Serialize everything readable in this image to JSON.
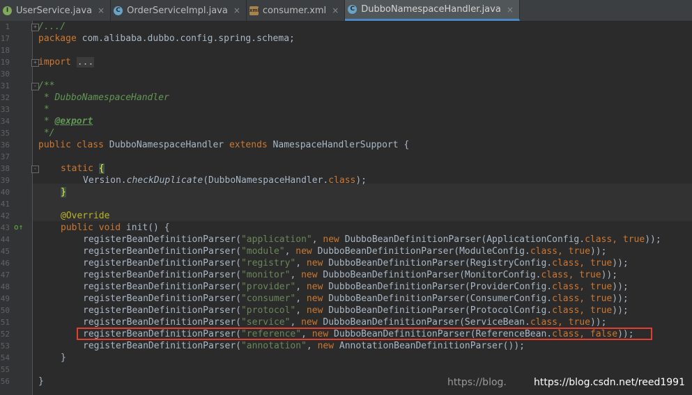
{
  "tabs": [
    {
      "icon": "I",
      "kind": "iface",
      "label": "UserService.java",
      "active": false
    },
    {
      "icon": "C",
      "kind": "cls",
      "label": "OrderServiceImpl.java",
      "active": false
    },
    {
      "icon": "xml",
      "kind": "xml",
      "label": "consumer.xml",
      "active": false
    },
    {
      "icon": "C",
      "kind": "cls",
      "label": "DubboNamespaceHandler.java",
      "active": true
    }
  ],
  "close_glyph": "×",
  "line_numbers": [
    "1",
    "17",
    "18",
    "19",
    "30",
    "31",
    "32",
    "33",
    "34",
    "35",
    "36",
    "37",
    "38",
    "39",
    "40",
    "41",
    "42",
    "43",
    "44",
    "45",
    "46",
    "47",
    "48",
    "49",
    "50",
    "51",
    "52",
    "53",
    "54",
    "55",
    "56"
  ],
  "code": {
    "l1": "/.../",
    "l17_kw": "package",
    "l17_rest": " com.alibaba.dubbo.config.spring.schema;",
    "l19_kw": "import",
    "l19_dots": "...",
    "l31": "/**",
    "l32": " * DubboNamespaceHandler",
    "l33": " *",
    "l34_pre": " * ",
    "l34_tag": "@export",
    "l35": " */",
    "l36_kw1": "public class",
    "l36_name": " DubboNamespaceHandler ",
    "l36_kw2": "extends",
    "l36_rest": " NamespaceHandlerSupport {",
    "l38_kw": "static",
    "l38_brace": "{",
    "l39_a": "Version.",
    "l39_method": "checkDuplicate",
    "l39_b": "(DubboNamespaceHandler.",
    "l39_kw": "class",
    "l39_c": ");",
    "l40_brace": "}",
    "l42": "@Override",
    "l43_kw": "public void",
    "l43_rest": " init() {",
    "reg": "registerBeanDefinitionParser(",
    "new_kw": "new",
    "class_kw": "class",
    "true_kw": "true",
    "false_kw": "false",
    "rows": [
      {
        "str": "\"application\"",
        "parser": " DubboBeanDefinitionParser(ApplicationConfig.",
        "flag": "true"
      },
      {
        "str": "\"module\"",
        "parser": " DubboBeanDefinitionParser(ModuleConfig.",
        "flag": "true"
      },
      {
        "str": "\"registry\"",
        "parser": " DubboBeanDefinitionParser(RegistryConfig.",
        "flag": "true"
      },
      {
        "str": "\"monitor\"",
        "parser": " DubboBeanDefinitionParser(MonitorConfig.",
        "flag": "true"
      },
      {
        "str": "\"provider\"",
        "parser": " DubboBeanDefinitionParser(ProviderConfig.",
        "flag": "true"
      },
      {
        "str": "\"consumer\"",
        "parser": " DubboBeanDefinitionParser(ConsumerConfig.",
        "flag": "true"
      },
      {
        "str": "\"protocol\"",
        "parser": " DubboBeanDefinitionParser(ProtocolConfig.",
        "flag": "true"
      },
      {
        "str": "\"service\"",
        "parser": " DubboBeanDefinitionParser(ServiceBean.",
        "flag": "true"
      },
      {
        "str": "\"reference\"",
        "parser": " DubboBeanDefinitionParser(ReferenceBean.",
        "flag": "false"
      }
    ],
    "l53_str": "\"annotation\"",
    "l53_rest": " AnnotationBeanDefinitionParser());",
    "close_brace": "}"
  },
  "watermark": "https://blog.csdn.net/reed1991",
  "watermark_ghost": "https://blog.",
  "colors": {
    "background": "#2b2b2b",
    "keyword": "#cc7832",
    "string": "#6a8759",
    "comment": "#629755",
    "annotation": "#bbb529",
    "highlight_box": "#e04030"
  }
}
